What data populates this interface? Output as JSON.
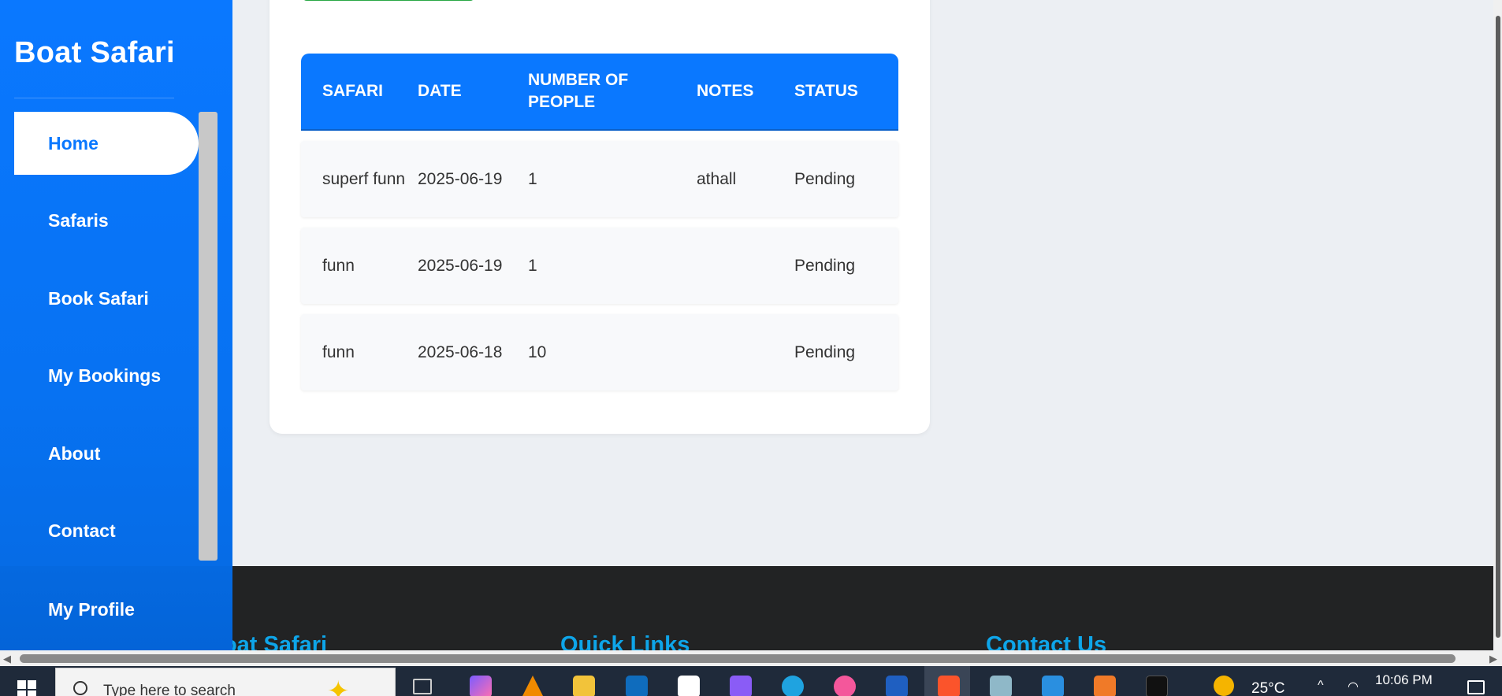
{
  "sidebar": {
    "brand": "Boat Safari",
    "items": [
      {
        "label": "Home",
        "active": true
      },
      {
        "label": "Safaris"
      },
      {
        "label": "Book Safari"
      },
      {
        "label": "My Bookings"
      },
      {
        "label": "About"
      },
      {
        "label": "Contact"
      },
      {
        "label": "My Profile"
      }
    ]
  },
  "table": {
    "headers": [
      "SAFARI",
      "DATE",
      "NUMBER OF PEOPLE",
      "NOTES",
      "STATUS"
    ],
    "rows": [
      {
        "safari": "superf funn",
        "date": "2025-06-19",
        "people": "1",
        "notes": "athall",
        "status": "Pending"
      },
      {
        "safari": "funn",
        "date": "2025-06-19",
        "people": "1",
        "notes": "",
        "status": "Pending"
      },
      {
        "safari": "funn",
        "date": "2025-06-18",
        "people": "10",
        "notes": "",
        "status": "Pending"
      }
    ]
  },
  "footer": {
    "brand": "Boat Safari",
    "quick_links": "Quick Links",
    "contact_us": "Contact Us"
  },
  "taskbar": {
    "search_placeholder": "Type here to search",
    "temperature": "25°C",
    "time": "10:06 PM"
  },
  "colors": {
    "accent": "#0a78ff",
    "footer_bg": "#222324",
    "footer_heading": "#0ea5e9",
    "page_bg": "#eceff3"
  }
}
